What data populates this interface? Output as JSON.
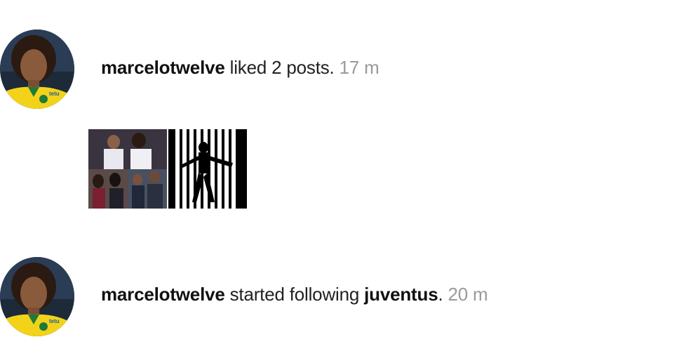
{
  "activities": [
    {
      "username": "marcelotwelve",
      "action": " liked 2 posts.",
      "timestamp": "17 m",
      "avatar_icon": "user-avatar",
      "thumbnails": [
        {
          "icon": "post-collage-thumbnail"
        },
        {
          "icon": "post-player-silhouette-thumbnail"
        }
      ]
    },
    {
      "username": "marcelotwelve",
      "action": " started following ",
      "target": "juventus",
      "suffix": ".",
      "timestamp": "20 m",
      "avatar_icon": "user-avatar"
    }
  ],
  "colors": {
    "text": "#222222",
    "timestamp": "#9a9a9a",
    "jersey_yellow": "#f3d21a",
    "background": "#ffffff"
  }
}
